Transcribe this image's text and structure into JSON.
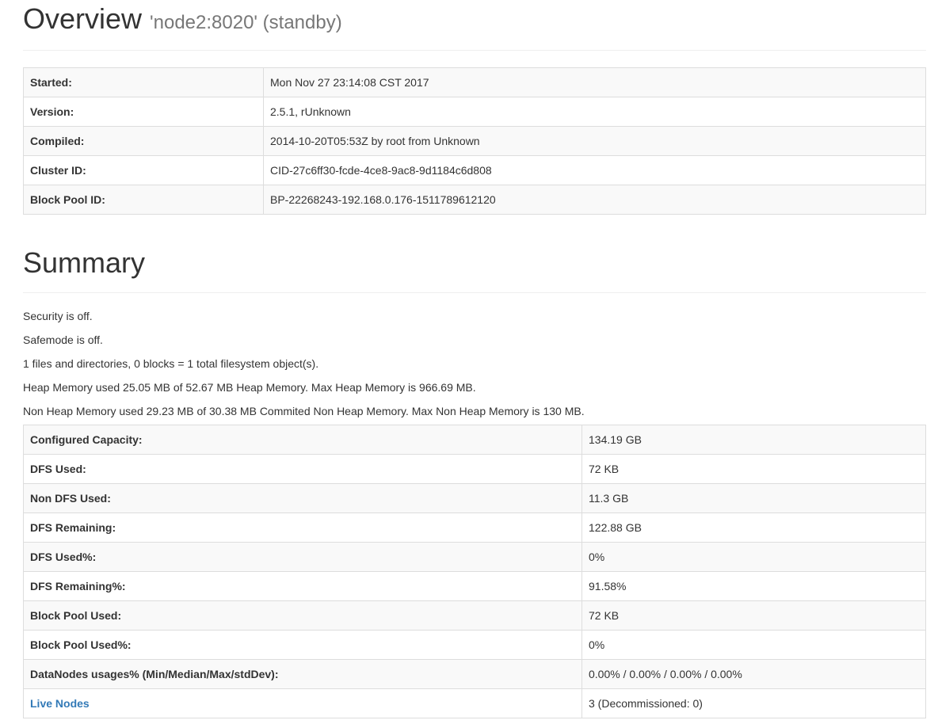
{
  "overview": {
    "title": "Overview",
    "subtitle": "'node2:8020' (standby)",
    "rows": [
      {
        "label": "Started:",
        "value": "Mon Nov 27 23:14:08 CST 2017"
      },
      {
        "label": "Version:",
        "value": "2.5.1, rUnknown"
      },
      {
        "label": "Compiled:",
        "value": "2014-10-20T05:53Z by root from Unknown"
      },
      {
        "label": "Cluster ID:",
        "value": "CID-27c6ff30-fcde-4ce8-9ac8-9d1184c6d808"
      },
      {
        "label": "Block Pool ID:",
        "value": "BP-22268243-192.168.0.176-1511789612120"
      }
    ]
  },
  "summary": {
    "title": "Summary",
    "lines": [
      "Security is off.",
      "Safemode is off.",
      "1 files and directories, 0 blocks = 1 total filesystem object(s).",
      "Heap Memory used 25.05 MB of 52.67 MB Heap Memory. Max Heap Memory is 966.69 MB.",
      "Non Heap Memory used 29.23 MB of 30.38 MB Commited Non Heap Memory. Max Non Heap Memory is 130 MB."
    ],
    "rows": [
      {
        "label": "Configured Capacity:",
        "value": "134.19 GB"
      },
      {
        "label": "DFS Used:",
        "value": "72 KB"
      },
      {
        "label": "Non DFS Used:",
        "value": "11.3 GB"
      },
      {
        "label": "DFS Remaining:",
        "value": "122.88 GB"
      },
      {
        "label": "DFS Used%:",
        "value": "0%"
      },
      {
        "label": "DFS Remaining%:",
        "value": "91.58%"
      },
      {
        "label": "Block Pool Used:",
        "value": "72 KB"
      },
      {
        "label": "Block Pool Used%:",
        "value": "0%"
      },
      {
        "label": "DataNodes usages% (Min/Median/Max/stdDev):",
        "value": "0.00% / 0.00% / 0.00% / 0.00%"
      },
      {
        "label": "Live Nodes",
        "value": "3 (Decommissioned: 0)"
      }
    ]
  },
  "colors": {
    "link": "#337ab7",
    "stripe": "#f9f9f9",
    "border": "#dddddd",
    "muted": "#777777"
  }
}
